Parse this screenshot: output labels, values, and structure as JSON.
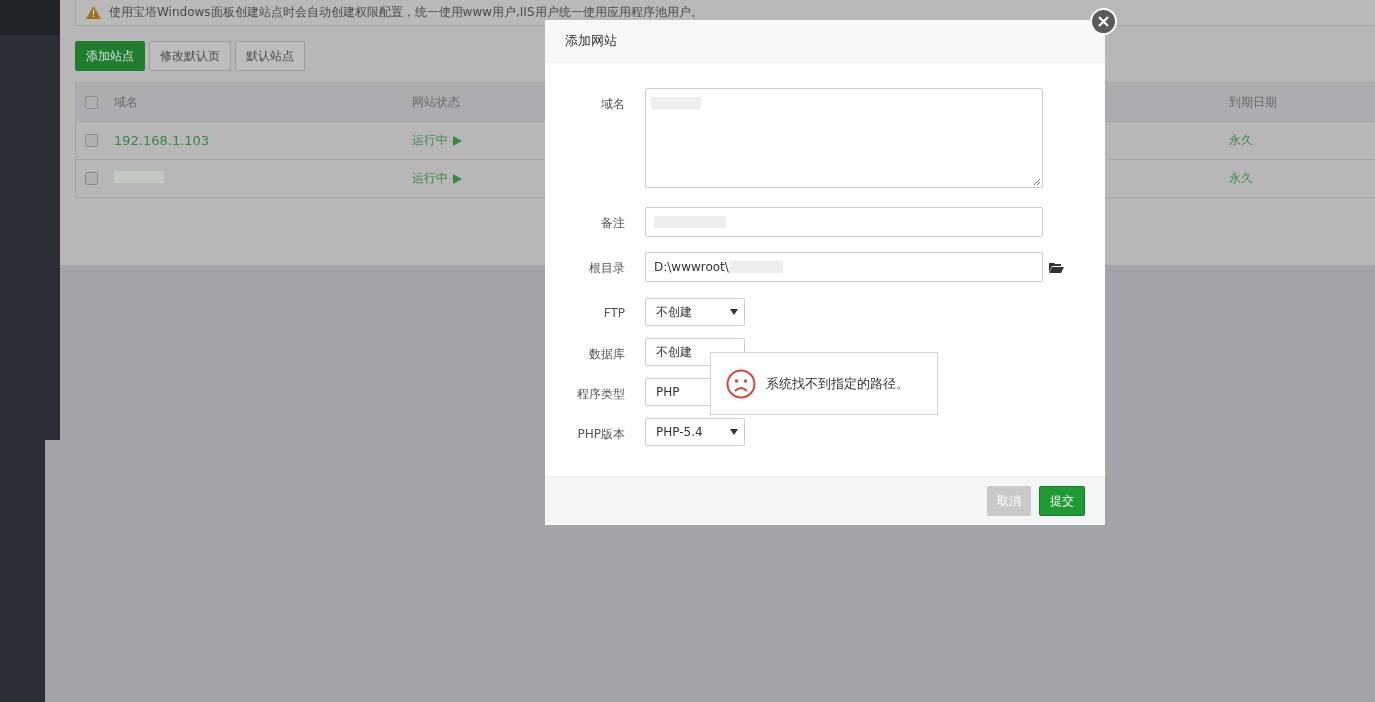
{
  "notice": {
    "text": "使用宝塔Windows面板创建站点时会自动创建权限配置，统一使用www用户,IIS用户统一使用应用程序池用户。"
  },
  "toolbar": [
    {
      "label": "添加站点",
      "kind": "primary"
    },
    {
      "label": "修改默认页",
      "kind": "default"
    },
    {
      "label": "默认站点",
      "kind": "default"
    }
  ],
  "table": {
    "header_checked": false,
    "columns": [
      "域名",
      "网站状态",
      "到期日期"
    ],
    "rows": [
      {
        "checked": false,
        "domain": "192.168.1.103",
        "status": "运行中",
        "expiry": "永久"
      },
      {
        "checked": false,
        "status": "运行中",
        "expiry": "永久"
      }
    ]
  },
  "modal": {
    "title": "添加网站",
    "fields": [
      {
        "kind": "textarea",
        "label": "域名"
      },
      {
        "kind": "input",
        "label": "备注"
      },
      {
        "kind": "path",
        "label": "根目录",
        "value": "D:\\wwwroot\\"
      },
      {
        "kind": "select",
        "label": "FTP",
        "value": "不创建"
      },
      {
        "kind": "select",
        "label": "数据库",
        "value": "不创建",
        "arrow_visible": false
      },
      {
        "kind": "select",
        "label": "程序类型",
        "value": "PHP"
      },
      {
        "kind": "select",
        "label": "PHP版本",
        "value": "PHP-5.4"
      }
    ],
    "buttons": [
      {
        "label": "取消",
        "kind": "cancel"
      },
      {
        "label": "提交",
        "kind": "submit"
      }
    ],
    "toast": {
      "text": "系统找不到指定的路径。"
    }
  }
}
